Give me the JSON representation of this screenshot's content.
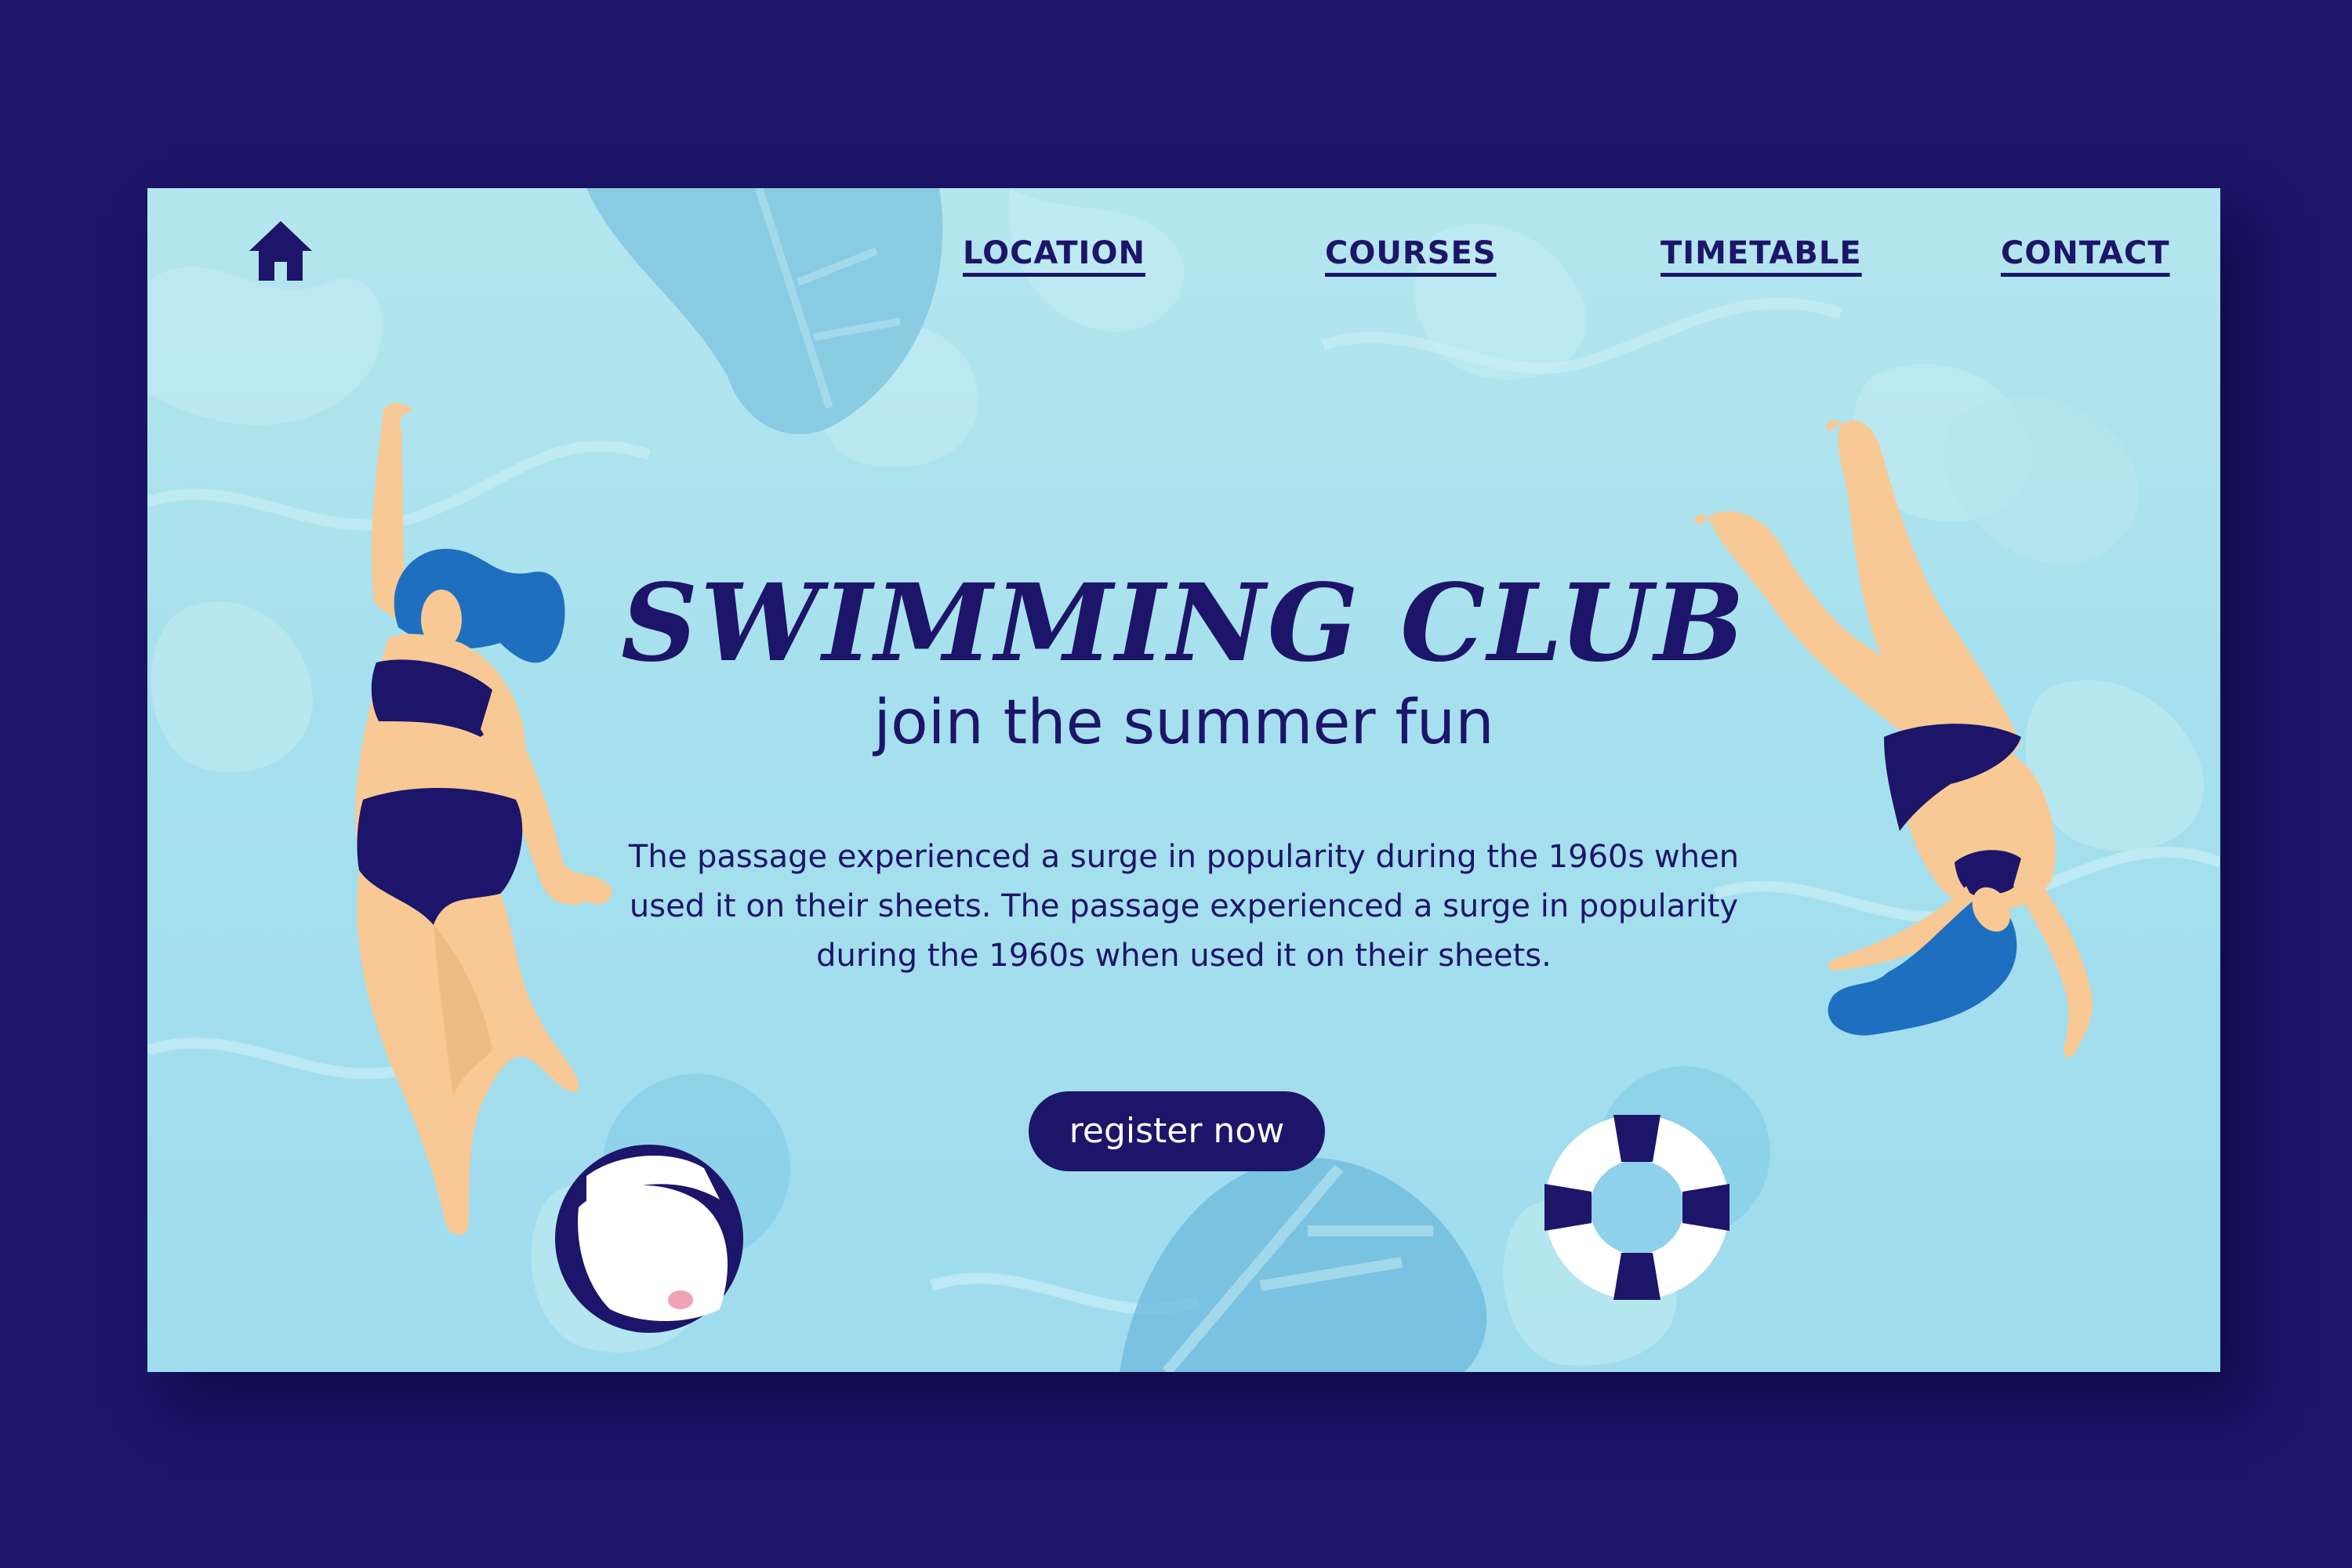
{
  "nav": {
    "home_icon": "home-icon",
    "links": [
      {
        "label": "LOCATION"
      },
      {
        "label": "COURSES"
      },
      {
        "label": "TIMETABLE"
      },
      {
        "label": "CONTACT"
      }
    ]
  },
  "hero": {
    "title": "SWIMMING CLUB",
    "subtitle": "join the summer fun",
    "body": "The passage experienced a surge in popularity during the 1960s when used it on their sheets. The passage experienced a surge in popularity during the 1960s when used it on their sheets.",
    "cta_label": "register now"
  },
  "colors": {
    "background": "#1d1569",
    "water": "#a6e0ee",
    "navy": "#1d1569",
    "skin": "#f8c994",
    "hair": "#1f6fc0",
    "leaf": "#6cb9dc"
  }
}
